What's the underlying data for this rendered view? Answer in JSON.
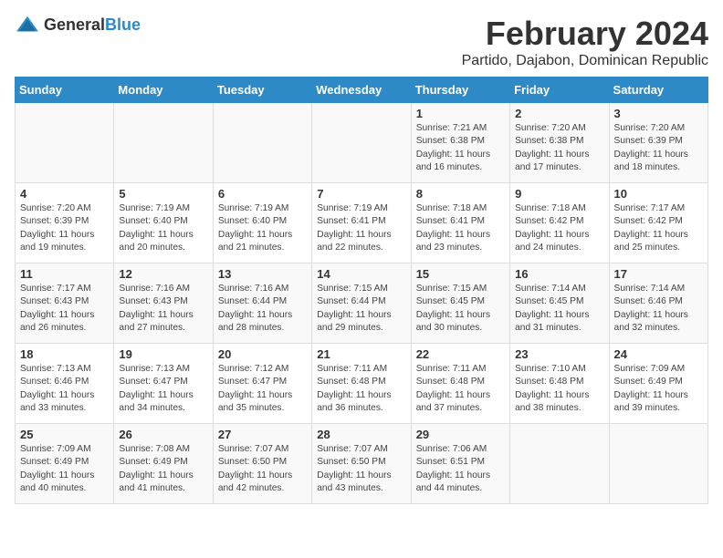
{
  "header": {
    "logo_general": "General",
    "logo_blue": "Blue",
    "month_year": "February 2024",
    "location": "Partido, Dajabon, Dominican Republic"
  },
  "days_of_week": [
    "Sunday",
    "Monday",
    "Tuesday",
    "Wednesday",
    "Thursday",
    "Friday",
    "Saturday"
  ],
  "weeks": [
    [
      {
        "day": "",
        "info": ""
      },
      {
        "day": "",
        "info": ""
      },
      {
        "day": "",
        "info": ""
      },
      {
        "day": "",
        "info": ""
      },
      {
        "day": "1",
        "info": "Sunrise: 7:21 AM\nSunset: 6:38 PM\nDaylight: 11 hours and 16 minutes."
      },
      {
        "day": "2",
        "info": "Sunrise: 7:20 AM\nSunset: 6:38 PM\nDaylight: 11 hours and 17 minutes."
      },
      {
        "day": "3",
        "info": "Sunrise: 7:20 AM\nSunset: 6:39 PM\nDaylight: 11 hours and 18 minutes."
      }
    ],
    [
      {
        "day": "4",
        "info": "Sunrise: 7:20 AM\nSunset: 6:39 PM\nDaylight: 11 hours and 19 minutes."
      },
      {
        "day": "5",
        "info": "Sunrise: 7:19 AM\nSunset: 6:40 PM\nDaylight: 11 hours and 20 minutes."
      },
      {
        "day": "6",
        "info": "Sunrise: 7:19 AM\nSunset: 6:40 PM\nDaylight: 11 hours and 21 minutes."
      },
      {
        "day": "7",
        "info": "Sunrise: 7:19 AM\nSunset: 6:41 PM\nDaylight: 11 hours and 22 minutes."
      },
      {
        "day": "8",
        "info": "Sunrise: 7:18 AM\nSunset: 6:41 PM\nDaylight: 11 hours and 23 minutes."
      },
      {
        "day": "9",
        "info": "Sunrise: 7:18 AM\nSunset: 6:42 PM\nDaylight: 11 hours and 24 minutes."
      },
      {
        "day": "10",
        "info": "Sunrise: 7:17 AM\nSunset: 6:42 PM\nDaylight: 11 hours and 25 minutes."
      }
    ],
    [
      {
        "day": "11",
        "info": "Sunrise: 7:17 AM\nSunset: 6:43 PM\nDaylight: 11 hours and 26 minutes."
      },
      {
        "day": "12",
        "info": "Sunrise: 7:16 AM\nSunset: 6:43 PM\nDaylight: 11 hours and 27 minutes."
      },
      {
        "day": "13",
        "info": "Sunrise: 7:16 AM\nSunset: 6:44 PM\nDaylight: 11 hours and 28 minutes."
      },
      {
        "day": "14",
        "info": "Sunrise: 7:15 AM\nSunset: 6:44 PM\nDaylight: 11 hours and 29 minutes."
      },
      {
        "day": "15",
        "info": "Sunrise: 7:15 AM\nSunset: 6:45 PM\nDaylight: 11 hours and 30 minutes."
      },
      {
        "day": "16",
        "info": "Sunrise: 7:14 AM\nSunset: 6:45 PM\nDaylight: 11 hours and 31 minutes."
      },
      {
        "day": "17",
        "info": "Sunrise: 7:14 AM\nSunset: 6:46 PM\nDaylight: 11 hours and 32 minutes."
      }
    ],
    [
      {
        "day": "18",
        "info": "Sunrise: 7:13 AM\nSunset: 6:46 PM\nDaylight: 11 hours and 33 minutes."
      },
      {
        "day": "19",
        "info": "Sunrise: 7:13 AM\nSunset: 6:47 PM\nDaylight: 11 hours and 34 minutes."
      },
      {
        "day": "20",
        "info": "Sunrise: 7:12 AM\nSunset: 6:47 PM\nDaylight: 11 hours and 35 minutes."
      },
      {
        "day": "21",
        "info": "Sunrise: 7:11 AM\nSunset: 6:48 PM\nDaylight: 11 hours and 36 minutes."
      },
      {
        "day": "22",
        "info": "Sunrise: 7:11 AM\nSunset: 6:48 PM\nDaylight: 11 hours and 37 minutes."
      },
      {
        "day": "23",
        "info": "Sunrise: 7:10 AM\nSunset: 6:48 PM\nDaylight: 11 hours and 38 minutes."
      },
      {
        "day": "24",
        "info": "Sunrise: 7:09 AM\nSunset: 6:49 PM\nDaylight: 11 hours and 39 minutes."
      }
    ],
    [
      {
        "day": "25",
        "info": "Sunrise: 7:09 AM\nSunset: 6:49 PM\nDaylight: 11 hours and 40 minutes."
      },
      {
        "day": "26",
        "info": "Sunrise: 7:08 AM\nSunset: 6:49 PM\nDaylight: 11 hours and 41 minutes."
      },
      {
        "day": "27",
        "info": "Sunrise: 7:07 AM\nSunset: 6:50 PM\nDaylight: 11 hours and 42 minutes."
      },
      {
        "day": "28",
        "info": "Sunrise: 7:07 AM\nSunset: 6:50 PM\nDaylight: 11 hours and 43 minutes."
      },
      {
        "day": "29",
        "info": "Sunrise: 7:06 AM\nSunset: 6:51 PM\nDaylight: 11 hours and 44 minutes."
      },
      {
        "day": "",
        "info": ""
      },
      {
        "day": "",
        "info": ""
      }
    ]
  ]
}
